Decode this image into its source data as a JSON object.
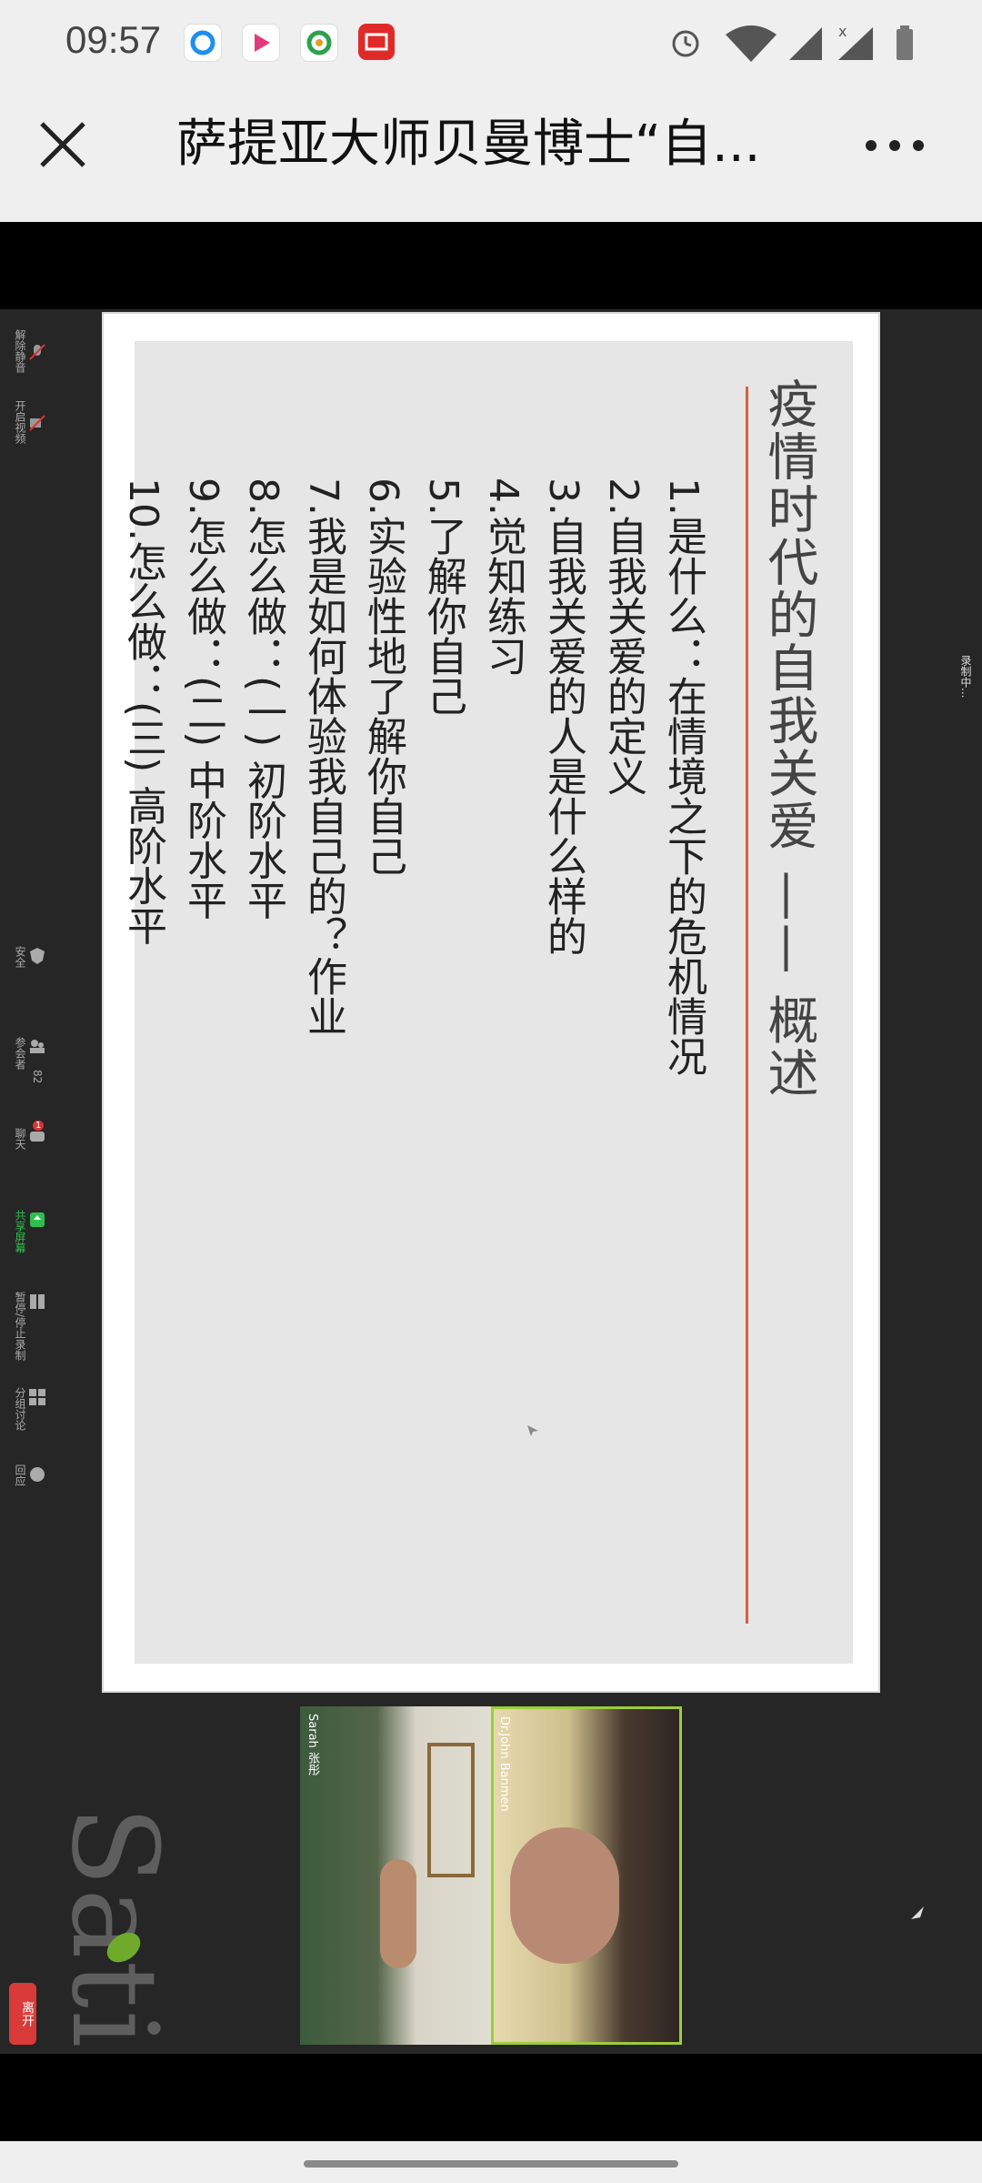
{
  "status_bar": {
    "time": "09:57"
  },
  "title_bar": {
    "title": "萨提亚大师贝曼博士“自...",
    "close_icon": "close-icon",
    "more_icon": "more-icon"
  },
  "zoom_toolbar": {
    "items": [
      {
        "label": "解除静音",
        "icon": "mic-muted-icon"
      },
      {
        "label": "开启视频",
        "icon": "video-off-icon"
      },
      {
        "label": "安全",
        "icon": "shield-icon"
      },
      {
        "label": "参会者",
        "icon": "participants-icon",
        "count": "82"
      },
      {
        "label": "聊天",
        "icon": "chat-icon",
        "badge": "1"
      },
      {
        "label": "共享屏幕",
        "icon": "share-screen-icon"
      },
      {
        "label": "暂停/停止录制",
        "icon": "pause-record-icon"
      },
      {
        "label": "分组讨论",
        "icon": "breakout-icon"
      },
      {
        "label": "回应",
        "icon": "reaction-icon"
      }
    ],
    "leave": "离开",
    "recording": "录制中..."
  },
  "slide": {
    "title": "疫情时代的自我关爱 —— 概述",
    "items": [
      {
        "num": "1.",
        "text": "是什么：在情境之下的危机情况"
      },
      {
        "num": "2.",
        "text": "自我关爱的定义"
      },
      {
        "num": "3.",
        "text": "自我关爱的人是什么样的"
      },
      {
        "num": "4.",
        "text": "觉知练习"
      },
      {
        "num": "5.",
        "text": "了解你自己"
      },
      {
        "num": "6.",
        "text": "实验性地了解你自己"
      },
      {
        "num": "7.",
        "text": "我是如何体验我自己的？作业"
      },
      {
        "num": "8.",
        "text": "怎么做：(一) 初阶水平"
      },
      {
        "num": "9.",
        "text": "怎么做：(二) 中阶水平"
      },
      {
        "num": "10.",
        "text": "怎么做：(三) 高阶水平"
      }
    ],
    "accent_color": "#d9603b"
  },
  "participants": [
    {
      "name": "Sarah 张彤"
    },
    {
      "name": "Dr.John Banmen"
    }
  ],
  "brand": {
    "text": "Satir"
  }
}
